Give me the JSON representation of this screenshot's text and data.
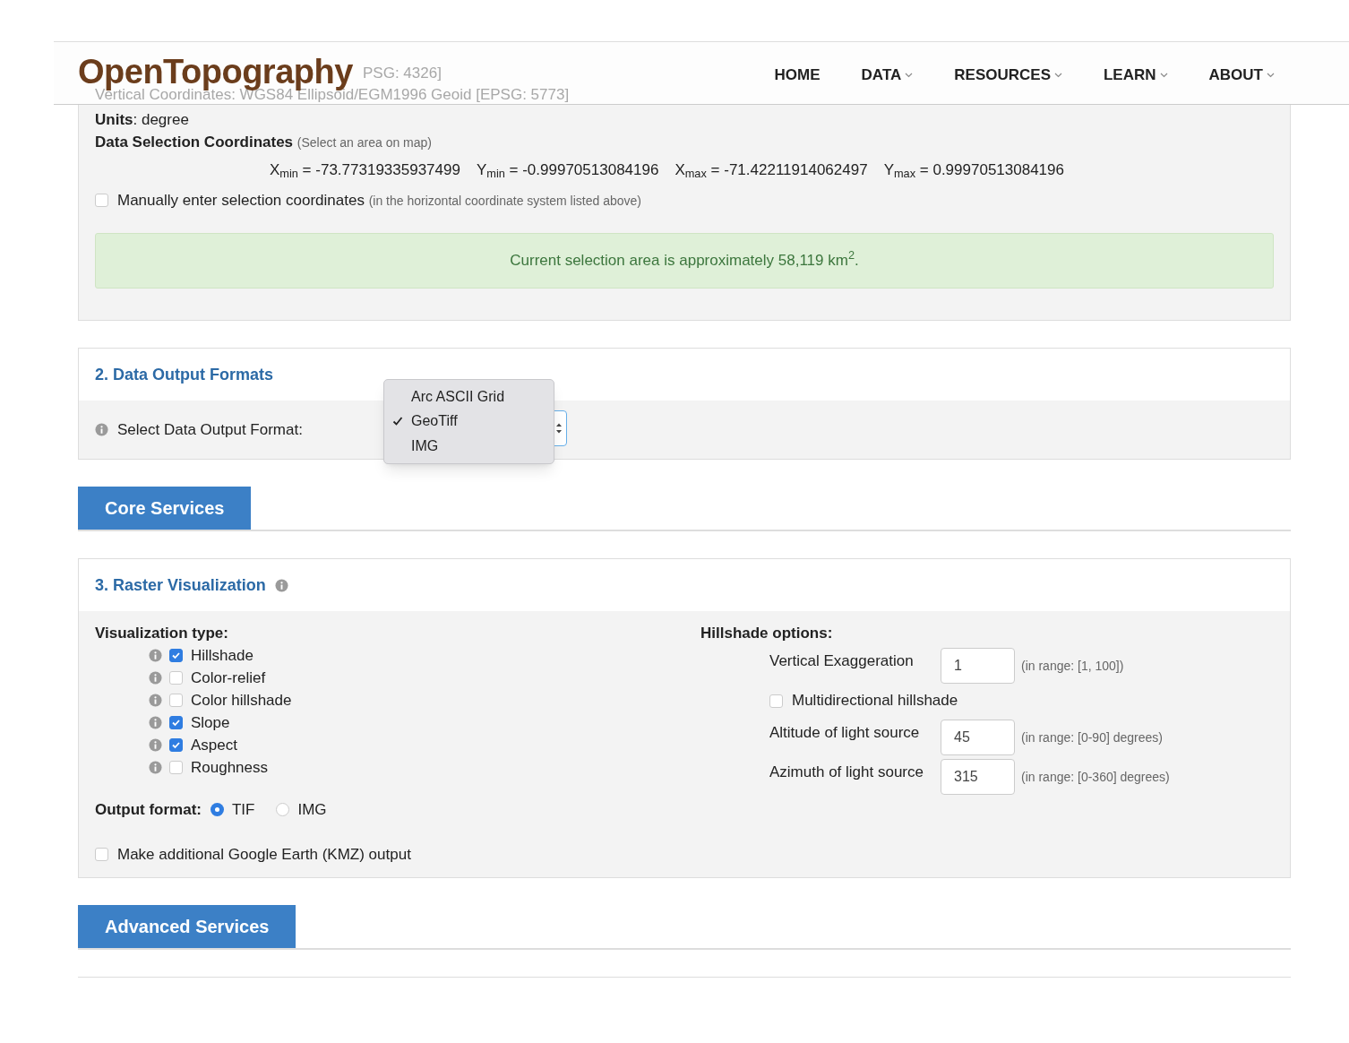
{
  "header": {
    "logo": "OpenTopography",
    "behind_text_1": "PSG: 4326]",
    "behind_text_2": "Vertical Coordinates: WGS84 Ellipsoid/EGM1996 Geoid [EPSG: 5773]",
    "nav": [
      {
        "label": "HOME",
        "dropdown": false
      },
      {
        "label": "DATA",
        "dropdown": true
      },
      {
        "label": "RESOURCES",
        "dropdown": true
      },
      {
        "label": "LEARN",
        "dropdown": true
      },
      {
        "label": "ABOUT",
        "dropdown": true
      }
    ]
  },
  "selection": {
    "units_label": "Units",
    "units_value": ": degree",
    "coords_label": "Data Selection Coordinates",
    "coords_hint": "(Select an area on map)",
    "coords": [
      "X$_{min}$ = -73.77319335937499",
      "Y$_{min}$ = -0.99970513084196",
      "X$_{max}$ = -71.42211914062497",
      "Y$_{max}$ = 0.99970513084196"
    ],
    "manual": {
      "label": "Manually enter selection coordinates",
      "hint": "(in the horizontal coordinate system listed above)",
      "checked": false
    },
    "alert": "Current selection area is approximately 58,119 km$^{2}$."
  },
  "output_formats": {
    "title": "2. Data Output Formats",
    "label": "Select Data Output Format:",
    "options": [
      {
        "label": "Arc ASCII Grid",
        "selected": false
      },
      {
        "label": "GeoTiff",
        "selected": true
      },
      {
        "label": "IMG",
        "selected": false
      }
    ]
  },
  "tabs": [
    {
      "label": "Core Services"
    },
    {
      "label": "Advanced Services"
    }
  ],
  "raster": {
    "title": "3. Raster Visualization",
    "type_label": "Visualization type:",
    "types": [
      {
        "label": "Hillshade",
        "checked": true
      },
      {
        "label": "Color-relief",
        "checked": false
      },
      {
        "label": "Color hillshade",
        "checked": false
      },
      {
        "label": "Slope",
        "checked": true
      },
      {
        "label": "Aspect",
        "checked": true
      },
      {
        "label": "Roughness",
        "checked": false
      }
    ],
    "output_label": "Output format:",
    "output_options": [
      {
        "label": "TIF",
        "selected": true
      },
      {
        "label": "IMG",
        "selected": false
      }
    ],
    "kmz": {
      "label": "Make additional Google Earth (KMZ) output",
      "checked": false
    },
    "hillshade_label": "Hillshade options:",
    "options": [
      {
        "kind": "field",
        "label": "Vertical Exaggeration",
        "value": "1",
        "hint": "(in range: [1, 100])"
      },
      {
        "kind": "checkbox",
        "label": "Multidirectional hillshade",
        "checked": false
      },
      {
        "kind": "field",
        "label": "Altitude of light source",
        "value": "45",
        "hint": "(in range: [0-90] degrees)"
      },
      {
        "kind": "field",
        "label": "Azimuth of light source",
        "value": "315",
        "hint": "(in range: [0-360] degrees)"
      }
    ]
  }
}
